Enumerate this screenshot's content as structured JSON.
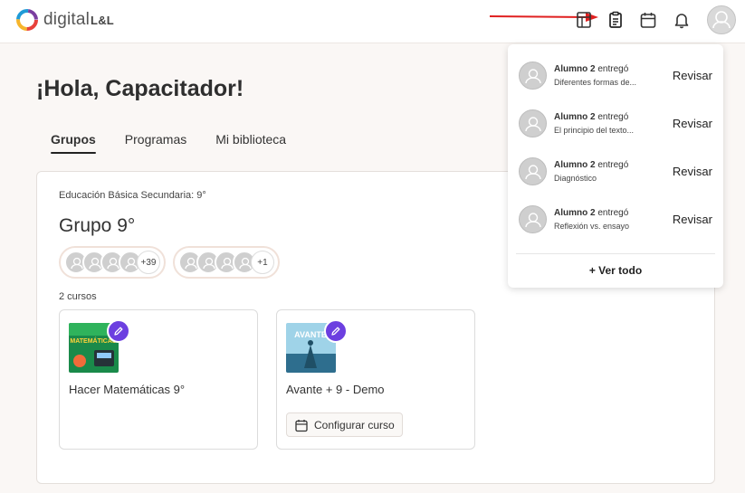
{
  "header": {
    "logo_text": "digital",
    "logo_suffix": "L&L",
    "icons": [
      "library-icon",
      "clipboard-icon",
      "calendar-icon",
      "bell-icon",
      "avatar"
    ]
  },
  "colors": {
    "accent": "#6c3fe0",
    "annotation_arrow": "#e02020"
  },
  "greeting": "¡Hola, Capacitador!",
  "tabs": [
    {
      "label": "Grupos",
      "active": true
    },
    {
      "label": "Programas",
      "active": false
    },
    {
      "label": "Mi biblioteca",
      "active": false
    }
  ],
  "group": {
    "level": "Educación Básica Secundaria: 9°",
    "title": "Grupo 9°",
    "members": [
      {
        "more": "+39"
      },
      {
        "more": "+1"
      }
    ],
    "courses_count": "2 cursos",
    "courses": [
      {
        "name": "Hacer Matemáticas 9°",
        "thumb_text": "MATEMÁTICAS",
        "config_label": ""
      },
      {
        "name": "Avante + 9 - Demo",
        "thumb_text": "AVANTE",
        "config_label": "Configurar curso"
      }
    ]
  },
  "notifications": {
    "items": [
      {
        "student": "Alumno 2",
        "verb": "entregó",
        "task": "Diferentes formas de...",
        "action": "Revisar"
      },
      {
        "student": "Alumno 2",
        "verb": "entregó",
        "task": "El principio del texto...",
        "action": "Revisar"
      },
      {
        "student": "Alumno 2",
        "verb": "entregó",
        "task": "Diagnóstico",
        "action": "Revisar"
      },
      {
        "student": "Alumno 2",
        "verb": "entregó",
        "task": "Reflexión vs. ensayo",
        "action": "Revisar"
      }
    ],
    "see_all": "+ Ver todo"
  }
}
